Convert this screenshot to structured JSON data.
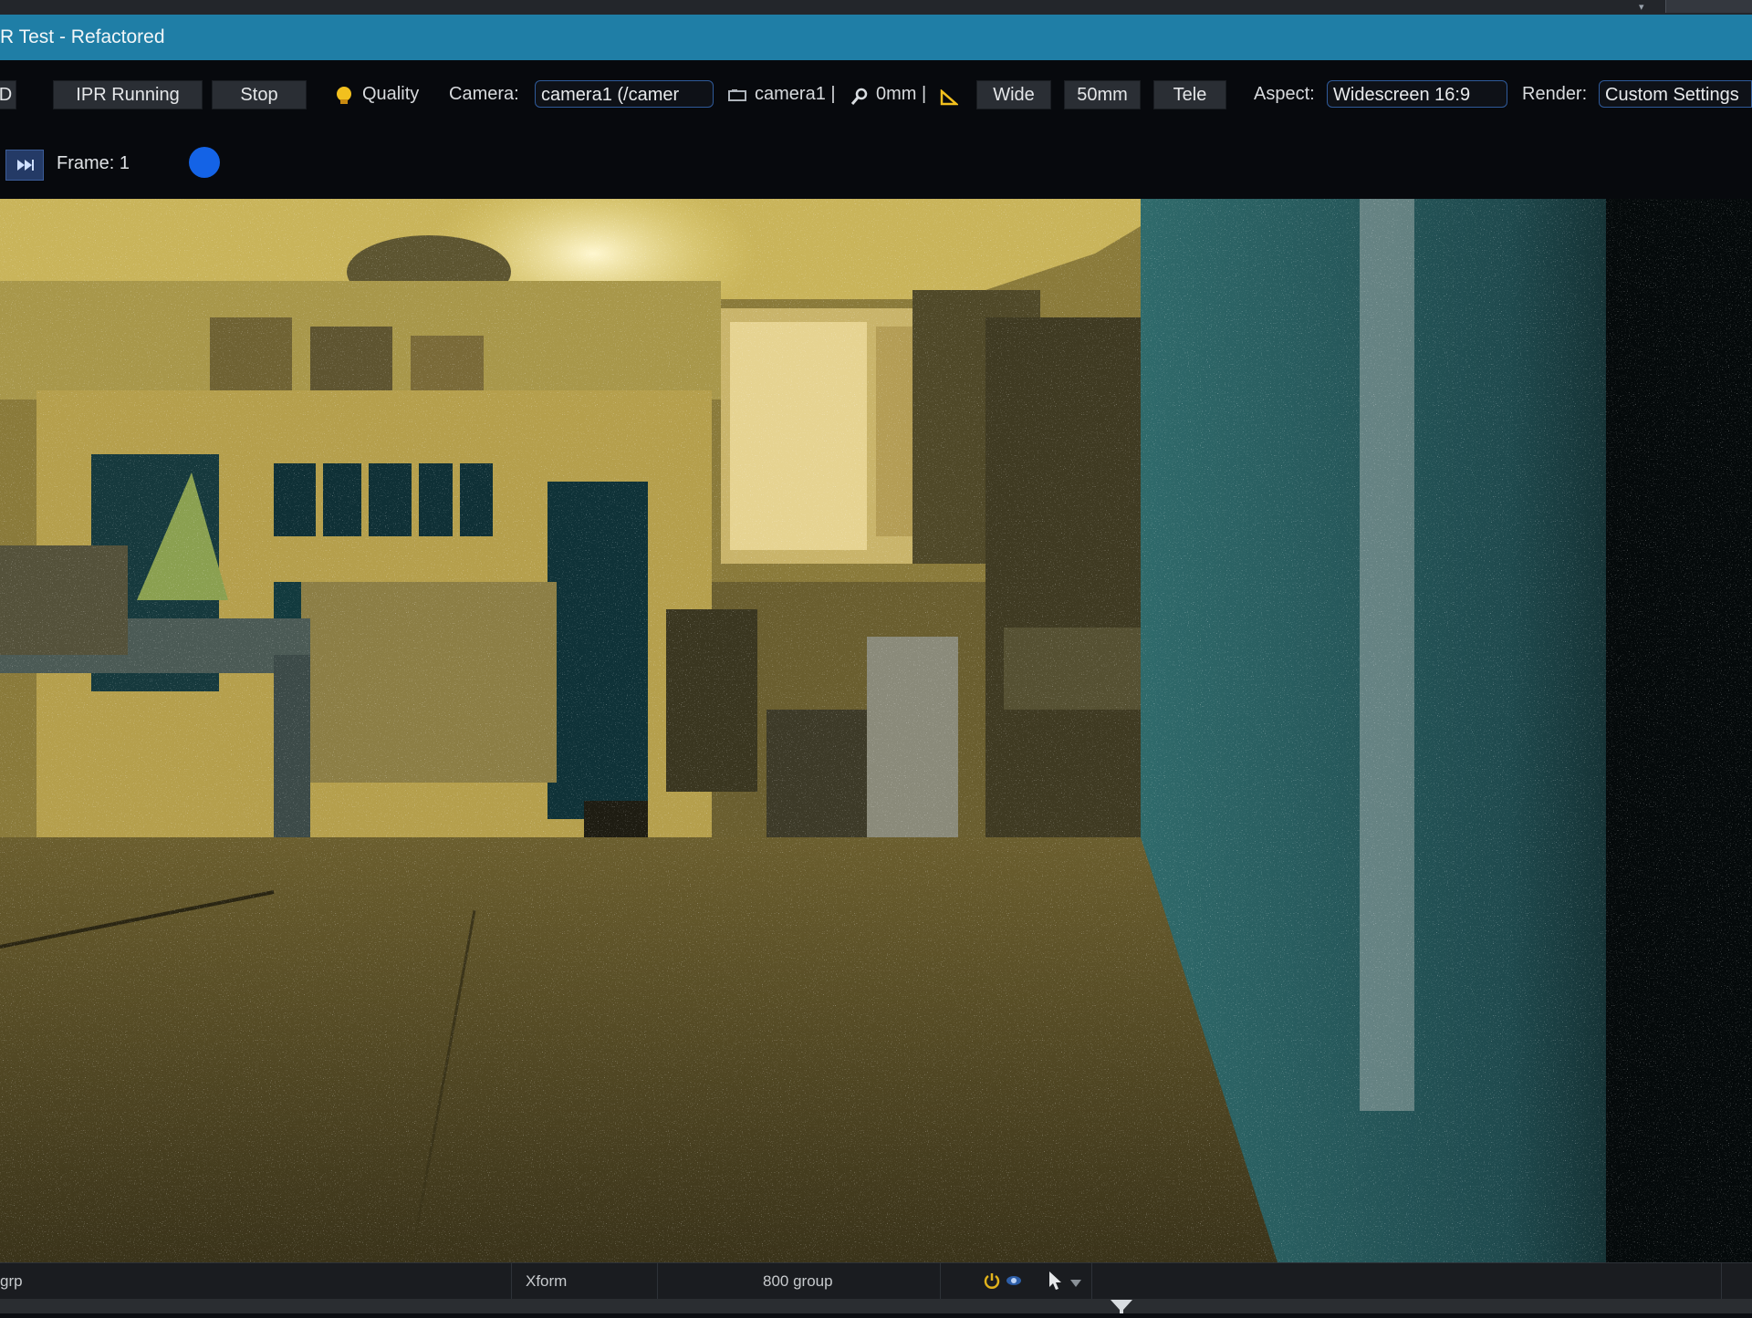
{
  "window": {
    "title": "R Test - Refactored"
  },
  "toolbar": {
    "partial_button": "D",
    "ipr_button": "IPR Running",
    "stop_button": "Stop",
    "quality_label": "Quality",
    "camera_label": "Camera:",
    "camera_value": "camera1 (/camer",
    "camera_readout": "camera1 |",
    "focal_readout": "0mm |",
    "wide_button": "Wide",
    "fifty_button": "50mm",
    "tele_button": "Tele",
    "aspect_label": "Aspect:",
    "aspect_value": "Widescreen 16:9",
    "render_label": "Render:",
    "render_value": "Custom Settings"
  },
  "framebar": {
    "frame_label": "Frame: 1"
  },
  "statusbar": {
    "left_text": "grp",
    "xform_text": "Xform",
    "group_text": "800 group"
  },
  "colors": {
    "title_bar": "#1f7ea6",
    "accent_dot": "#1463e6",
    "quality_icon": "#f2c01e"
  },
  "icons": [
    "quality-bulb-icon",
    "camera-icon",
    "zoom-icon",
    "triangle-icon",
    "play-forward-icon",
    "power-icon",
    "eye-icon",
    "cursor-icon",
    "dropdown-arrow-icon",
    "filter-icon"
  ]
}
